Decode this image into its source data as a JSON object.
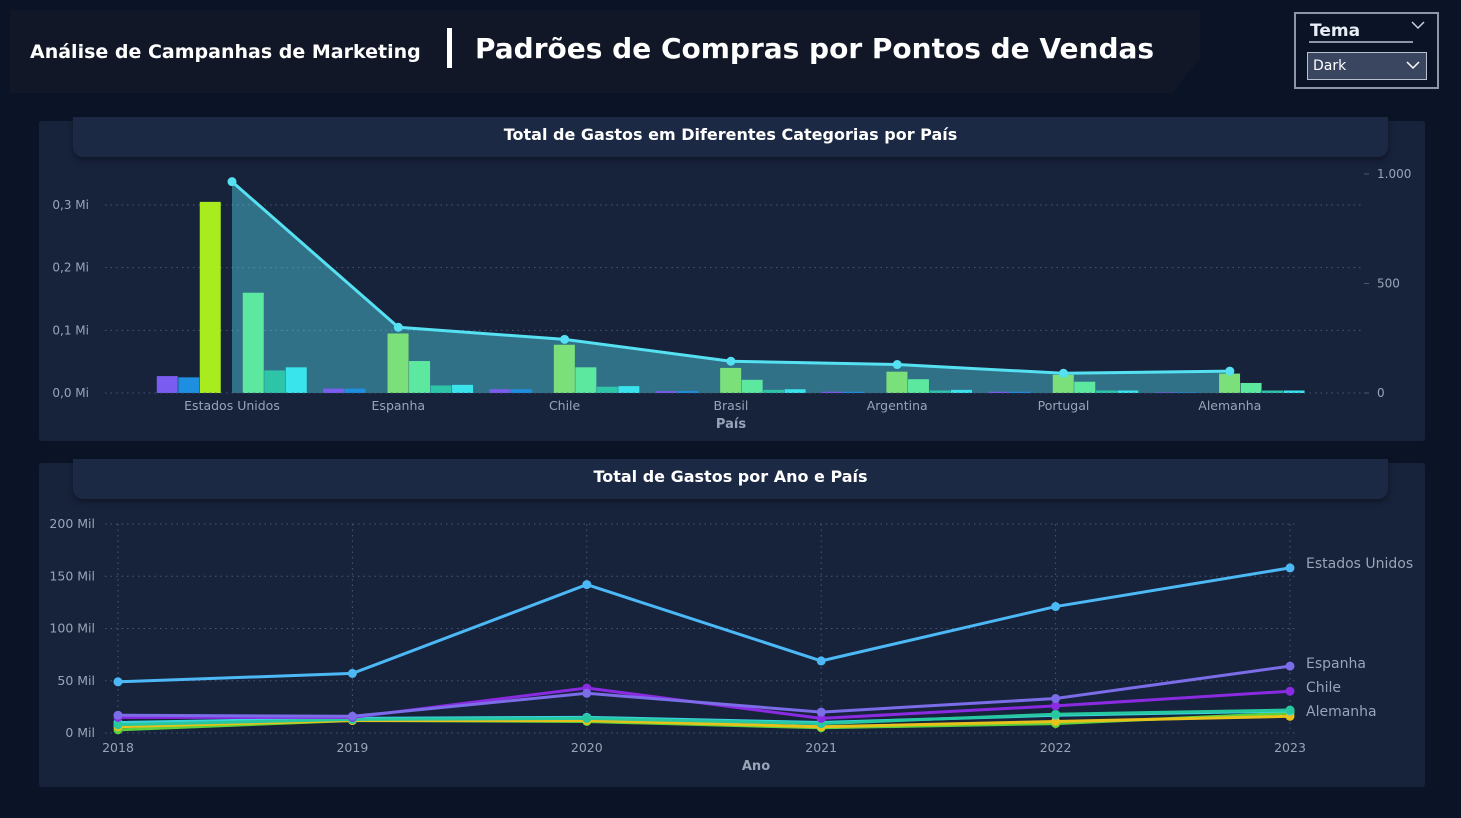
{
  "header": {
    "subtitle": "Análise de Campanhas de Marketing",
    "title": "Padrões de Compras por Pontos de Vendas"
  },
  "theme_selector": {
    "label": "Tema",
    "value": "Dark"
  },
  "colors": {
    "background": "#0b1426",
    "panel": "#17223b",
    "line_cyan": "#56e1f2"
  },
  "chart_data": [
    {
      "type": "bar",
      "title": "Total de Gastos em Diferentes Categorias por País",
      "xlabel": "País",
      "ylabel": "",
      "categories": [
        "Estados Unidos",
        "Espanha",
        "Chile",
        "Brasil",
        "Argentina",
        "Portugal",
        "Alemanha"
      ],
      "y_ticks": [
        "0,0 Mi",
        "0,1 Mi",
        "0,2 Mi",
        "0,3 Mi"
      ],
      "y_tick_values": [
        0,
        0.1,
        0.2,
        0.3
      ],
      "ylim": [
        0,
        0.33
      ],
      "y2_ticks": [
        "0",
        "500",
        "1.000"
      ],
      "y2_tick_values": [
        0,
        500,
        1000
      ],
      "y2lim": [
        0,
        1000
      ],
      "grid": true,
      "legend": "none",
      "series": [
        {
          "color": "#7a5cf0",
          "values": [
            0.027,
            0.007,
            0.006,
            0.003,
            0.002,
            0.002,
            0.001
          ]
        },
        {
          "color": "#1e8fe0",
          "values": [
            0.025,
            0.007,
            0.006,
            0.003,
            0.002,
            0.002,
            0.001
          ]
        },
        {
          "color": "#a8ec1e",
          "values": [
            0.305,
            0.0,
            0.0,
            0.0,
            0.0,
            0.0,
            0.0
          ]
        },
        {
          "color": "#7be07a",
          "values": [
            0.0,
            0.095,
            0.077,
            0.04,
            0.034,
            0.029,
            0.031
          ]
        },
        {
          "color": "#5de8a0",
          "values": [
            0.16,
            0.051,
            0.041,
            0.021,
            0.022,
            0.018,
            0.016
          ]
        },
        {
          "color": "#2ec4a8",
          "values": [
            0.036,
            0.012,
            0.01,
            0.005,
            0.004,
            0.004,
            0.004
          ]
        },
        {
          "color": "#3ae4ec",
          "values": [
            0.041,
            0.013,
            0.011,
            0.006,
            0.005,
            0.004,
            0.004
          ]
        }
      ],
      "line_series": {
        "axis": "y2",
        "color": "#56e1f2",
        "values": [
          965,
          300,
          245,
          145,
          130,
          90,
          100
        ]
      }
    },
    {
      "type": "line",
      "title": "Total de Gastos por Ano e País",
      "xlabel": "Ano",
      "ylabel": "",
      "x": [
        2018,
        2019,
        2020,
        2021,
        2022,
        2023
      ],
      "y_ticks": [
        "0 Mil",
        "50 Mil",
        "100 Mil",
        "150 Mil",
        "200 Mil"
      ],
      "y_tick_values": [
        0,
        50,
        100,
        150,
        200
      ],
      "ylim": [
        0,
        200
      ],
      "grid": true,
      "legend": "end-of-line labels",
      "series": [
        {
          "name": "Estados Unidos",
          "color": "#4cb8f5",
          "values": [
            49,
            57,
            142,
            69,
            121,
            158
          ]
        },
        {
          "name": "Espanha",
          "color": "#7b6ce8",
          "values": [
            17,
            16,
            38,
            20,
            33,
            64
          ]
        },
        {
          "name": "Chile",
          "color": "#8a2be2",
          "values": [
            15,
            15,
            43,
            14,
            26,
            40
          ]
        },
        {
          "name": "Alemanha",
          "color": "#27c79f",
          "values": [
            8,
            13,
            14,
            9,
            18,
            22
          ]
        },
        {
          "color": "#e8c21a",
          "values": [
            6,
            12,
            12,
            6,
            11,
            16
          ]
        },
        {
          "color": "#3ad4e0",
          "values": [
            10,
            14,
            15,
            10,
            17,
            21
          ]
        },
        {
          "color": "#5bd13a",
          "values": [
            3,
            12,
            11,
            5,
            9,
            19
          ]
        }
      ]
    }
  ]
}
